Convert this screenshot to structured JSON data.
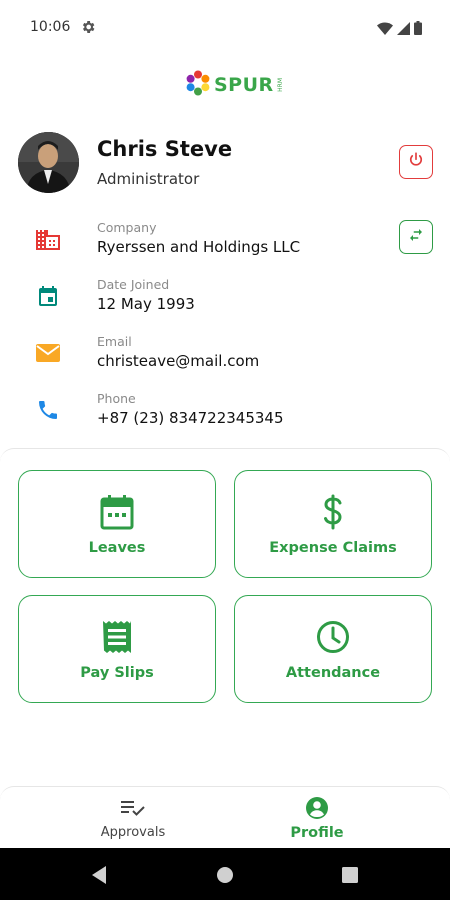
{
  "status_bar": {
    "time": "10:06"
  },
  "logo": {
    "text": "SPUR",
    "sub": "HRM"
  },
  "profile": {
    "name": "Chris Steve",
    "role": "Administrator"
  },
  "info": {
    "company": {
      "label": "Company",
      "value": "Ryerssen and Holdings LLC"
    },
    "date_joined": {
      "label": "Date Joined",
      "value": "12 May 1993"
    },
    "email": {
      "label": "Email",
      "value": "christeave@mail.com"
    },
    "phone": {
      "label": "Phone",
      "value": "+87 (23) 834722345345"
    }
  },
  "tiles": [
    {
      "label": "Leaves",
      "icon": "calendar-icon"
    },
    {
      "label": "Expense Claims",
      "icon": "dollar-icon"
    },
    {
      "label": "Pay Slips",
      "icon": "receipt-icon"
    },
    {
      "label": "Attendance",
      "icon": "clock-icon"
    }
  ],
  "bottom_nav": {
    "items": [
      {
        "label": "Approvals",
        "icon": "checklist-icon",
        "active": false
      },
      {
        "label": "Profile",
        "icon": "account-circle-icon",
        "active": true
      }
    ]
  },
  "colors": {
    "accent_green": "#2e9b45",
    "danger_red": "#e23c3c",
    "company_icon": "#e53935",
    "date_icon": "#00897b",
    "email_icon": "#f9a825",
    "phone_icon": "#1e88e5"
  }
}
